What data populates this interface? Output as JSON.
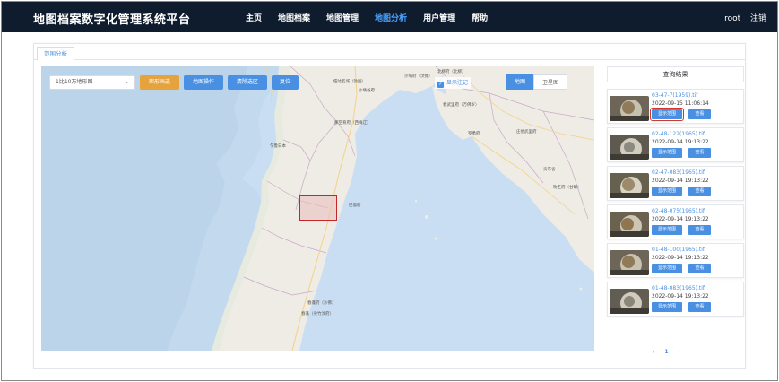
{
  "app_title": "地图档案数字化管理系统平台",
  "nav": [
    "主页",
    "地图档案",
    "地图管理",
    "地图分析",
    "用户管理",
    "帮助"
  ],
  "nav_active": "地图分析",
  "user": {
    "name": "root",
    "logout": "注销"
  },
  "tab": "范围分析",
  "toolbar": {
    "select_value": "1比10万地形图",
    "btn_rect": "矩形画选",
    "btn_op": "地图操作",
    "btn_clear": "清除选区",
    "btn_reset": "复位",
    "visible": "显示注记",
    "layer_map": "地图",
    "layer_sat": "卫星图"
  },
  "map_labels": {
    "l1": "佃达瓦城（勃固）",
    "l2": "沙埇谷府",
    "l3": "沙埇府（汶抛）",
    "l4": "沙汶府（汶抛）",
    "l5": "北柳府（北柳）",
    "l6": "差哥府（勃固）",
    "l7": "乍鲁日本",
    "l8": "那空育府（西梅辽）",
    "l9": "罗勇府",
    "l10": "春武里府（万佛岁）",
    "l11": "佛丕府",
    "l12": "庄他武里府",
    "l13": "贡布省",
    "l14": "叻丕府（甘帮）",
    "l15": "丹老市",
    "l16": "春蓬府（沙佛）",
    "l17": "巴蜀府",
    "l18": "春蓬（尖竹汶府）",
    "l19": "茂宜府"
  },
  "results": {
    "title": "查询结果",
    "show_label": "显示范围",
    "view_label": "查看",
    "items": [
      {
        "name": "03-47-7(1959).tif",
        "time": "2022-09-15 11:06:14"
      },
      {
        "name": "02-48-122(1965).tif",
        "time": "2022-09-14 19:13:22"
      },
      {
        "name": "02-47-083(1965).tif",
        "time": "2022-09-14 19:13:22"
      },
      {
        "name": "02-48-075(1965).tif",
        "time": "2022-09-14 19:13:22"
      },
      {
        "name": "01-48-100(1965).tif",
        "time": "2022-09-14 19:13:22"
      },
      {
        "name": "01-48-083(1965).tif",
        "time": "2022-09-14 19:13:22"
      }
    ]
  },
  "pager": {
    "prev": "‹",
    "page": "1",
    "next": "›"
  }
}
